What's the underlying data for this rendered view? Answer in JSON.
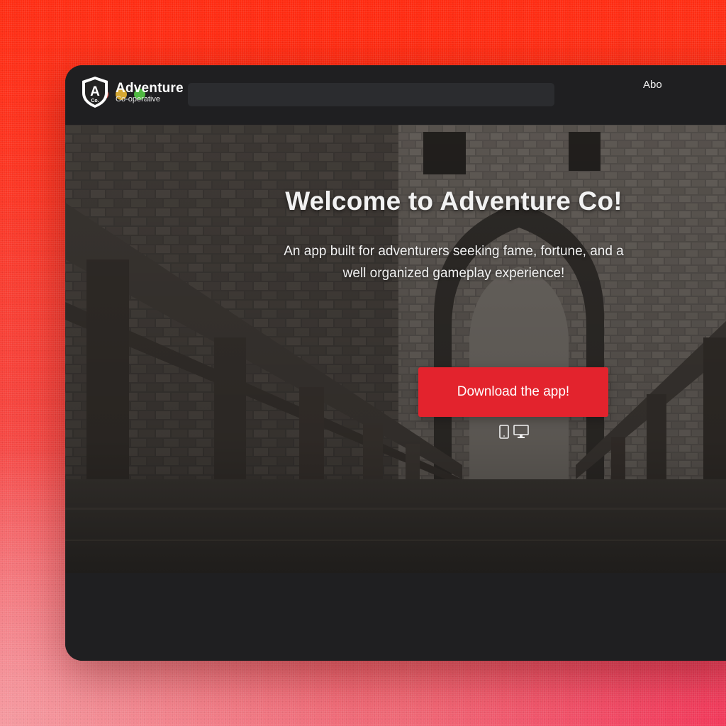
{
  "window": {
    "controls": [
      "close",
      "minimize",
      "maximize"
    ]
  },
  "nav": {
    "brand_title": "Adventure",
    "brand_subtitle": "Co-operative",
    "logo_mark": "A",
    "logo_mark_sub": "Co.",
    "link_about": "Abo"
  },
  "hero": {
    "title": "Welcome to Adventure Co!",
    "subtitle_line1": "An app built for adventurers seeking fame, fortune, and a",
    "subtitle_line2": "well organized gameplay experience!",
    "cta_label": "Download the app!",
    "platform_icons": [
      "tablet-icon",
      "desktop-icon"
    ]
  },
  "colors": {
    "accent": "#e3232d",
    "window_bg": "#1f1f21",
    "address_bar": "#2b2c2f",
    "dot_red": "#ee5a52",
    "dot_yellow": "#d6a832",
    "dot_green": "#4fb841"
  }
}
